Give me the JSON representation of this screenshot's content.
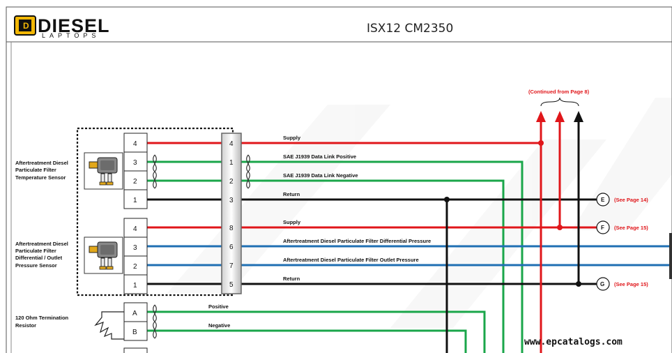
{
  "header": {
    "logo_text": "DIESEL",
    "logo_subtext": "LAPTOPS",
    "title": "ISX12 CM2350"
  },
  "continued_note": "(Continued from Page 8)",
  "components": [
    {
      "id": "temp-sensor",
      "label_lines": [
        "Aftertreatment Diesel",
        "Particulate Filter",
        "Temperature Sensor"
      ]
    },
    {
      "id": "press-sensor",
      "label_lines": [
        "Aftertreatment Diesel",
        "Particulate Filter",
        "Differential / Outlet",
        "Pressure Sensor"
      ]
    },
    {
      "id": "resistor",
      "label_lines": [
        "120 Ohm Termination",
        "Resistor"
      ]
    }
  ],
  "connector_pins": {
    "temp_sensor": [
      "4",
      "3",
      "2",
      "1"
    ],
    "press_sensor": [
      "4",
      "3",
      "2",
      "1"
    ],
    "resistor": [
      "A",
      "B"
    ]
  },
  "splice_pins": [
    "4",
    "1",
    "2",
    "3",
    "8",
    "6",
    "7",
    "5"
  ],
  "wires": [
    {
      "label": "Supply",
      "color": "#e0161a"
    },
    {
      "label": "SAE J1939 Data Link Positive",
      "color": "#1aa64a"
    },
    {
      "label": "SAE J1939 Data Link Negative",
      "color": "#1aa64a"
    },
    {
      "label": "Return",
      "color": "#111111"
    },
    {
      "label": "Supply",
      "color": "#e0161a"
    },
    {
      "label": "Aftertreatment Diesel Particulate Filter Differential Pressure",
      "color": "#1f6fb3"
    },
    {
      "label": "Aftertreatment Diesel Particulate Filter Outlet Pressure",
      "color": "#1f6fb3"
    },
    {
      "label": "Return",
      "color": "#111111"
    },
    {
      "label": "Positive",
      "color": "#1aa64a"
    },
    {
      "label": "Negative",
      "color": "#1aa64a"
    }
  ],
  "nodes": [
    {
      "letter": "E",
      "ref": "(See Page 14)"
    },
    {
      "letter": "F",
      "ref": "(See Page 15)"
    },
    {
      "letter": "G",
      "ref": "(See Page 15)"
    }
  ],
  "watermark": "www.epcatalogs.com",
  "colors": {
    "red": "#e0161a",
    "green": "#1aa64a",
    "blue": "#1f6fb3",
    "black": "#111111",
    "logo_yellow": "#f2b705"
  }
}
